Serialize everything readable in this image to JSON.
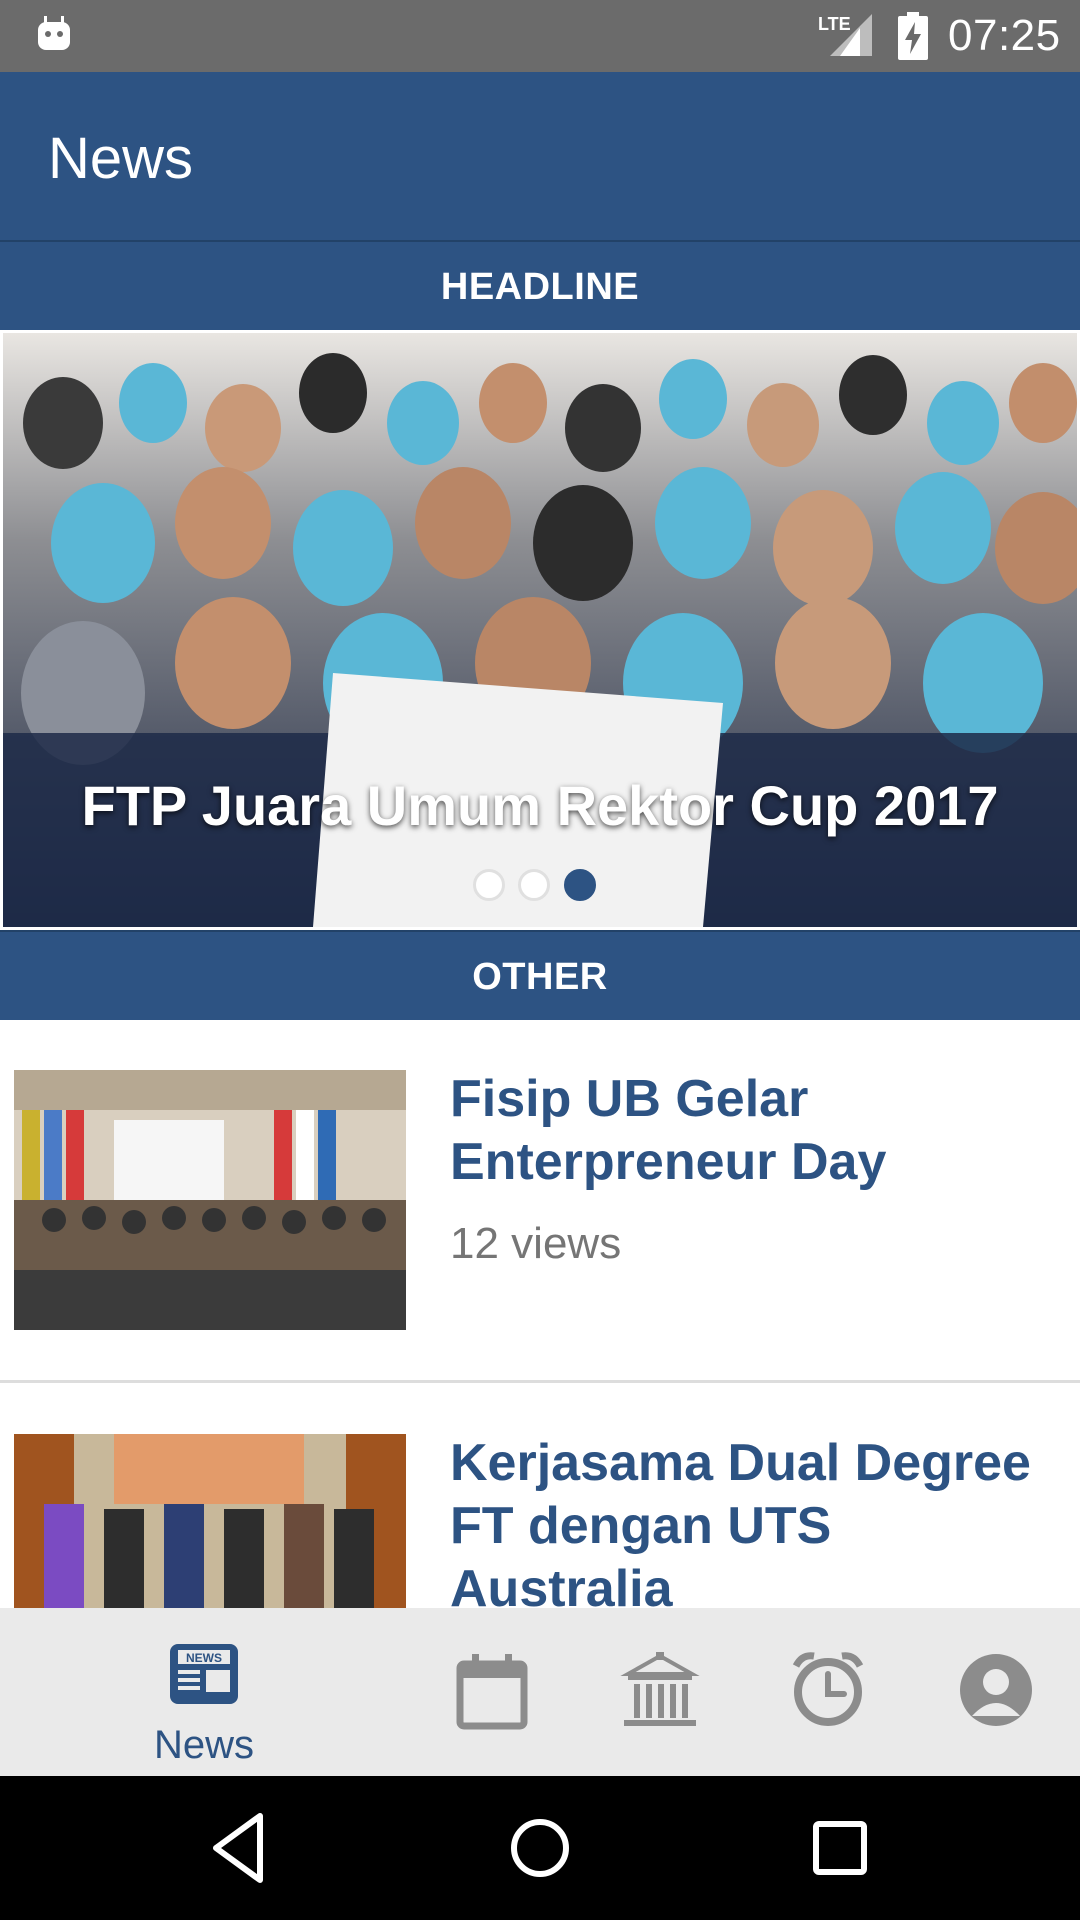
{
  "status_bar": {
    "time": "07:25",
    "network_label": "LTE",
    "icons": [
      "android-notification-icon",
      "lte-signal-icon",
      "battery-charging-icon"
    ]
  },
  "app_bar": {
    "title": "News"
  },
  "sections": {
    "headline": "HEADLINE",
    "other": "OTHER"
  },
  "headline": {
    "title": "FTP Juara Umum Rektor Cup 2017",
    "page_count": 3,
    "active_page": 3
  },
  "news_list": [
    {
      "title": "Fisip UB Gelar Enterpreneur Day",
      "views": "12 views"
    },
    {
      "title": "Kerjasama Dual Degree FT dengan UTS Australia",
      "views": ""
    }
  ],
  "bottom_nav": {
    "items": [
      {
        "label": "News",
        "icon": "news-icon",
        "selected": true
      },
      {
        "label": "",
        "icon": "calendar-icon",
        "selected": false
      },
      {
        "label": "",
        "icon": "building-icon",
        "selected": false
      },
      {
        "label": "",
        "icon": "alarm-clock-icon",
        "selected": false
      },
      {
        "label": "",
        "icon": "profile-icon",
        "selected": false
      }
    ]
  },
  "colors": {
    "primary": "#2d5383",
    "status_bar": "#6b6b6b",
    "nav_bg": "#eaeaea",
    "nav_inactive": "#8c8c8c",
    "views_text": "#757575"
  },
  "system_nav": {
    "icons": [
      "back-icon",
      "home-icon",
      "recents-icon"
    ]
  }
}
